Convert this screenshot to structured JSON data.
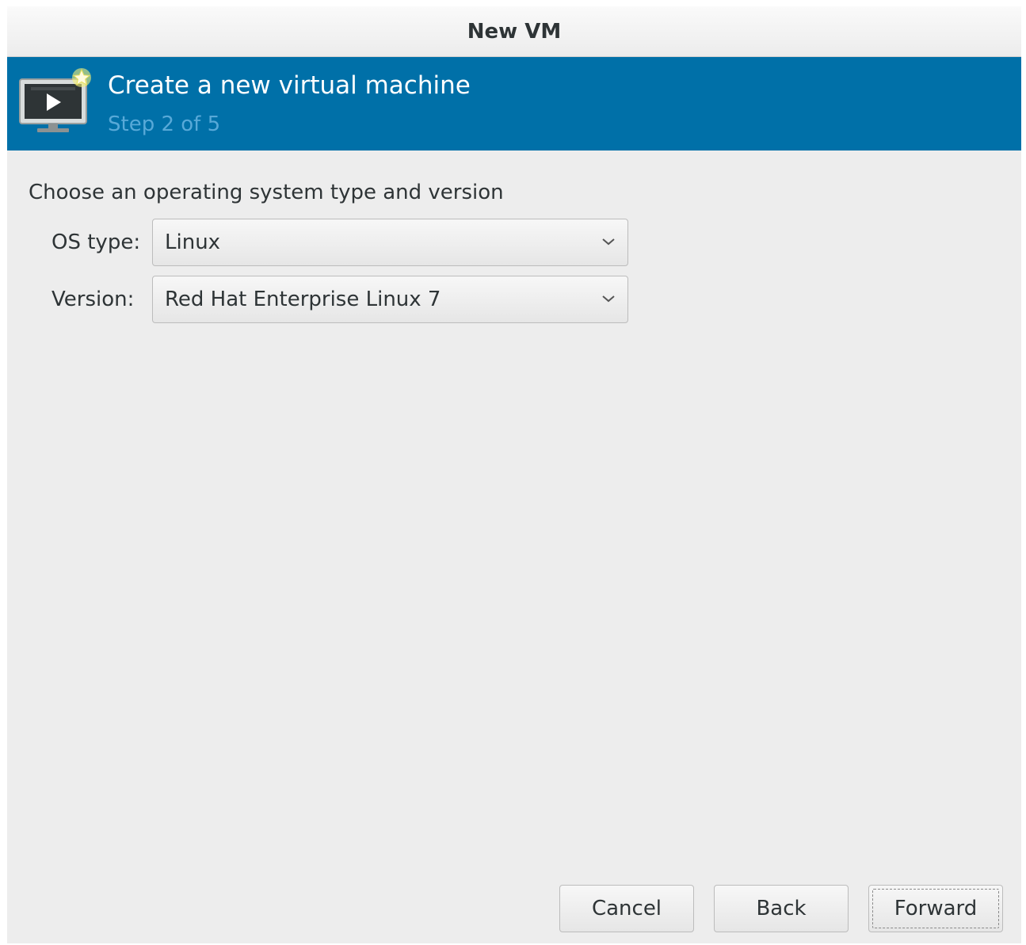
{
  "window": {
    "title": "New VM"
  },
  "banner": {
    "heading": "Create a new virtual machine",
    "step": "Step 2 of 5",
    "icon": "vm-monitor-play-star-icon",
    "color": "#0070a8"
  },
  "form": {
    "prompt": "Choose an operating system type and version",
    "os_type": {
      "label": "OS type:",
      "value": "Linux"
    },
    "version": {
      "label": "Version:",
      "value": "Red Hat Enterprise Linux 7"
    }
  },
  "buttons": {
    "cancel": "Cancel",
    "back": "Back",
    "forward": "Forward"
  }
}
